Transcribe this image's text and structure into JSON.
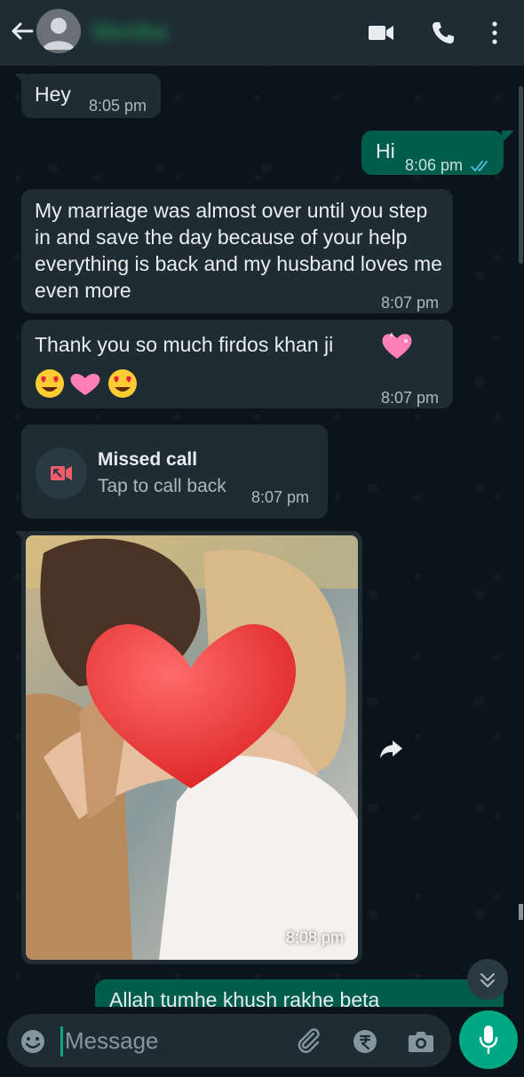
{
  "header": {
    "contact_name": "Monika",
    "icons": [
      "back-arrow-icon",
      "avatar-icon",
      "video-call-icon",
      "phone-icon",
      "more-options-icon"
    ]
  },
  "messages": [
    {
      "direction": "incoming",
      "text": "Hey",
      "time": "8:05 pm"
    },
    {
      "direction": "outgoing",
      "text": "Hi",
      "time": "8:06 pm",
      "status": "read"
    },
    {
      "direction": "incoming",
      "text": "My marriage was almost over until you step in and save the day because of your help everything is back and my husband loves me even more",
      "time": "8:07 pm"
    },
    {
      "direction": "incoming",
      "text": "Thank you so much firdos khan ji",
      "time": "8:07 pm",
      "emoji": [
        "sparkling-heart",
        "heart-eyes",
        "sparkling-heart",
        "heart-eyes"
      ]
    },
    {
      "direction": "incoming",
      "type": "missed_call",
      "title": "Missed call",
      "subtitle": "Tap to call back",
      "time": "8:07 pm"
    },
    {
      "direction": "incoming",
      "type": "image",
      "time": "8:08 pm"
    },
    {
      "direction": "outgoing",
      "text": "Allah tumhe khush rakhe beta"
    }
  ],
  "input": {
    "placeholder": "Message"
  },
  "colors": {
    "background": "#0b141a",
    "header": "#1f2c34",
    "incoming_bubble": "#1f2c34",
    "outgoing_bubble": "#005c4b",
    "accent": "#00a884",
    "read_tick": "#53bdeb"
  }
}
